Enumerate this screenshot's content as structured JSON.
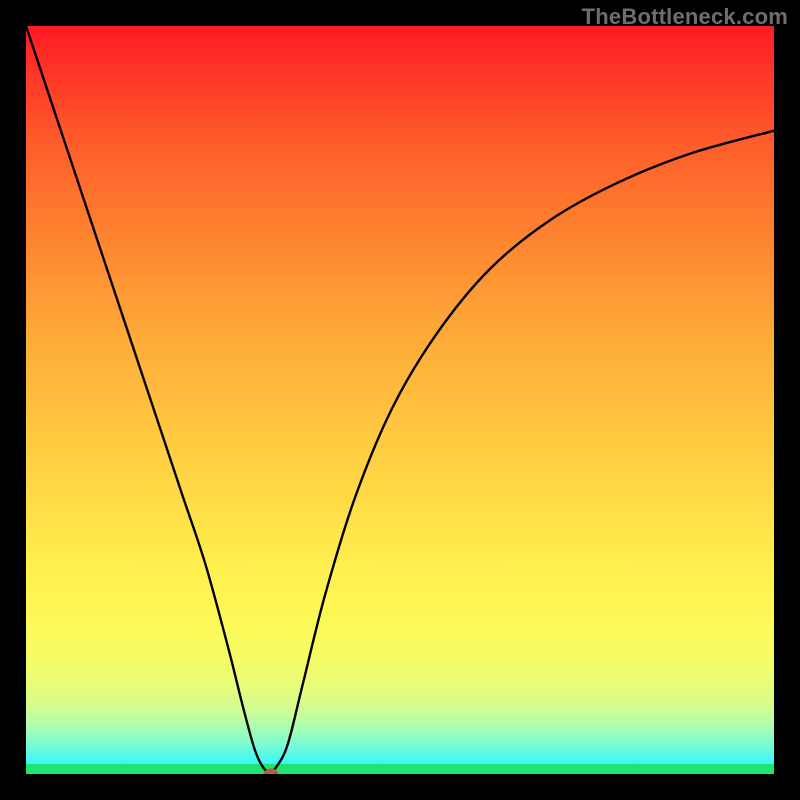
{
  "watermark": "TheBottleneck.com",
  "chart_data": {
    "type": "line",
    "title": "",
    "xlabel": "",
    "ylabel": "",
    "xlim": [
      0,
      100
    ],
    "ylim": [
      0,
      100
    ],
    "x": [
      0,
      3,
      6,
      9,
      12,
      15,
      18,
      21,
      24,
      27,
      29,
      30.5,
      31.5,
      32.5,
      33.5,
      35,
      37,
      40,
      44,
      49,
      55,
      62,
      70,
      79,
      89,
      100
    ],
    "values": [
      100,
      91,
      82,
      73,
      64,
      55,
      46,
      37,
      28,
      17,
      9,
      3.5,
      1.2,
      0.2,
      1.0,
      4,
      12,
      24,
      37,
      49,
      59,
      67.5,
      74,
      79,
      83,
      86
    ],
    "marker": {
      "x": 32.7,
      "y": 0.0
    },
    "gradient_stops": [
      {
        "pos": 0,
        "color": "#fe1b23"
      },
      {
        "pos": 50,
        "color": "#ffce42"
      },
      {
        "pos": 80,
        "color": "#fdfa58"
      },
      {
        "pos": 99,
        "color": "#2ef3fc"
      },
      {
        "pos": 100,
        "color": "#1fe46f"
      }
    ]
  }
}
